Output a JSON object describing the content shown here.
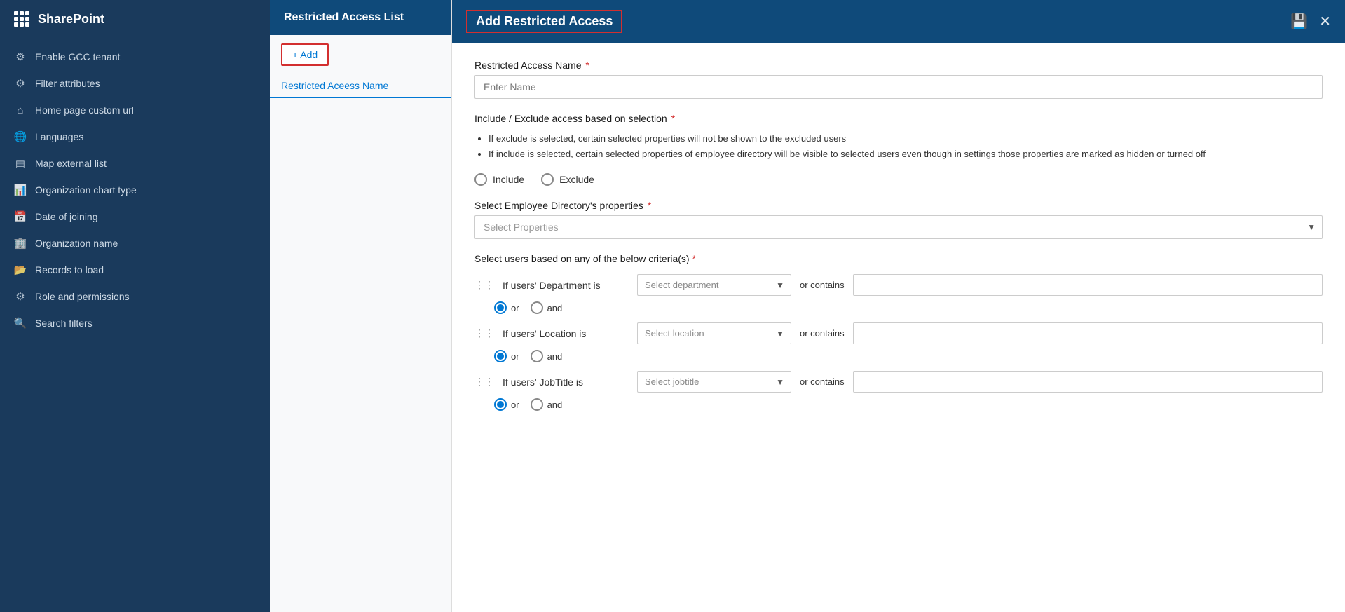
{
  "app": {
    "title": "SharePoint"
  },
  "sidebar": {
    "items": [
      {
        "id": "enable-gcc",
        "label": "Enable GCC tenant",
        "icon": "⚙"
      },
      {
        "id": "filter-attributes",
        "label": "Filter attributes",
        "icon": "⚙"
      },
      {
        "id": "home-page",
        "label": "Home page custom url",
        "icon": "🏠"
      },
      {
        "id": "languages",
        "label": "Languages",
        "icon": "🌐"
      },
      {
        "id": "map-external",
        "label": "Map external list",
        "icon": "📋"
      },
      {
        "id": "org-chart",
        "label": "Organization chart type",
        "icon": "📊"
      },
      {
        "id": "date-joining",
        "label": "Date of joining",
        "icon": "📅"
      },
      {
        "id": "org-name",
        "label": "Organization name",
        "icon": "🏢"
      },
      {
        "id": "records-load",
        "label": "Records to load",
        "icon": "📂"
      },
      {
        "id": "role-permissions",
        "label": "Role and permissions",
        "icon": "⚙"
      },
      {
        "id": "search-filters",
        "label": "Search filters",
        "icon": "🔍"
      }
    ]
  },
  "list_panel": {
    "title": "Restricted Access List",
    "add_button": "+ Add",
    "column_header": "Restricted Aceess Name"
  },
  "modal": {
    "title": "Add Restricted Access",
    "fields": {
      "name": {
        "label": "Restricted Access Name",
        "placeholder": "Enter Name",
        "required": true
      },
      "include_exclude": {
        "label": "Include / Exclude access based on selection",
        "required": true,
        "bullet1": "If exclude is selected, certain selected properties will not be shown to the excluded users",
        "bullet2": "If include is selected, certain selected properties of employee directory will be visible to selected users even though in settings those properties are marked as hidden or turned off",
        "options": [
          {
            "id": "include",
            "label": "Include"
          },
          {
            "id": "exclude",
            "label": "Exclude"
          }
        ]
      },
      "emp_directory": {
        "label": "Select Employee Directory's properties",
        "placeholder": "Select Properties",
        "required": true
      },
      "criteria": {
        "label": "Select users based on any of the below criteria(s)",
        "required": true,
        "rows": [
          {
            "label": "If users' Department is",
            "placeholder": "Select department",
            "or_contains": "or contains"
          },
          {
            "label": "If users' Location is",
            "placeholder": "Select location",
            "or_contains": "or contains"
          },
          {
            "label": "If users' JobTitle is",
            "placeholder": "Select jobtitle",
            "or_contains": "or contains"
          }
        ],
        "logic_or": "or",
        "logic_and": "and"
      }
    }
  }
}
